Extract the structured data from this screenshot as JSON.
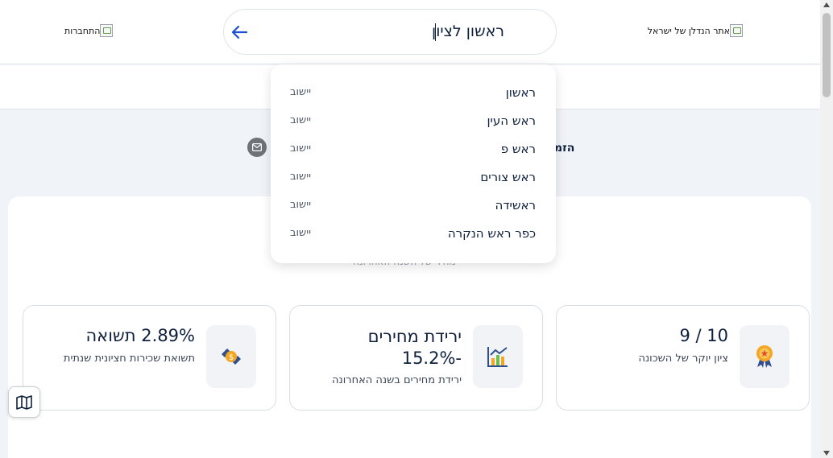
{
  "header": {
    "login_alt": "התחברות",
    "logo_alt": "אתר הנדלן של ישראל"
  },
  "search": {
    "value": "ראשון לציון",
    "back_icon": "arrow-left-icon"
  },
  "background": {
    "title_partial": "הזמ",
    "subtitle_partial": "מחיר של השנה האחרונה"
  },
  "suggestions": [
    {
      "name": "ראשון",
      "type": "יישוב"
    },
    {
      "name": "ראש העין",
      "type": "יישוב"
    },
    {
      "name": "ראש פ",
      "type": "יישוב"
    },
    {
      "name": "ראש צורים",
      "type": "יישוב"
    },
    {
      "name": "ראשידה",
      "type": "יישוב"
    },
    {
      "name": "כפר ראש הנקרה",
      "type": "יישוב"
    }
  ],
  "stats": [
    {
      "value": "10 / 9",
      "label": "ציון יוקר של השכונה",
      "icon": "award-ribbon-icon"
    },
    {
      "value": "ירידת מחירים -15.2%",
      "label": "ירידת מחירים בשנה האחרונה",
      "icon": "bar-chart-trend-icon"
    },
    {
      "value": "2.89% תשואה",
      "label": "תשואת שכירות חציונית שנתית",
      "icon": "money-exchange-icon"
    }
  ],
  "colors": {
    "accent": "#1f4fd1",
    "text": "#0e1f3d",
    "tile": "#f1f3f7"
  }
}
